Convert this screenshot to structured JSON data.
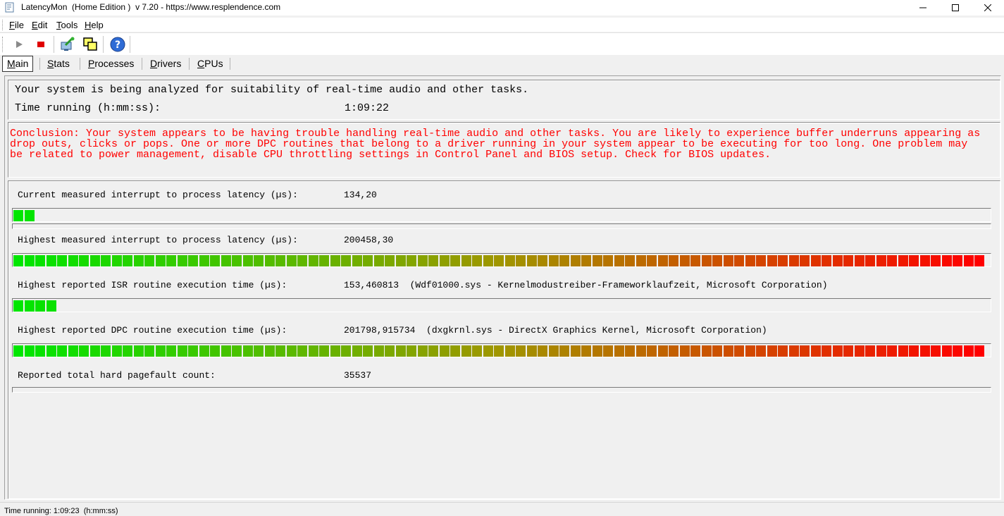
{
  "window": {
    "title": "LatencyMon  (Home Edition )  v 7.20 - https://www.resplendence.com"
  },
  "menu": {
    "items": [
      {
        "key": "F",
        "rest": "ile"
      },
      {
        "key": "E",
        "rest": "dit"
      },
      {
        "key": "T",
        "rest": "ools"
      },
      {
        "key": "H",
        "rest": "elp"
      }
    ]
  },
  "toolbar": {
    "icons": [
      "play-icon",
      "stop-icon",
      "analyze-icon",
      "window-icon",
      "help-icon"
    ]
  },
  "tabs": [
    {
      "key": "M",
      "rest": "ain",
      "active": true
    },
    {
      "key": "S",
      "rest": "tats",
      "active": false
    },
    {
      "key": "P",
      "rest": "rocesses",
      "active": false
    },
    {
      "key": "D",
      "rest": "rivers",
      "active": false
    },
    {
      "key": "C",
      "rest": "PUs",
      "active": false
    }
  ],
  "main": {
    "analysis_text": "Your system is being analyzed for suitability of real-time audio and other tasks.",
    "time_label": "Time running (h:mm:ss):",
    "time_value": "1:09:22",
    "conclusion": "Conclusion: Your system appears to be having trouble handling real-time audio and other tasks. You are likely to experience buffer underruns appearing as\ndrop outs, clicks or pops. One or more DPC routines that belong to a driver running in your system appear to be executing for too long. One problem may\nbe related to power management, disable CPU throttling settings in Control Panel and BIOS setup. Check for BIOS updates.",
    "rows": [
      {
        "label": "Current measured interrupt to process latency (µs):",
        "value": "134,20",
        "fill": 0.02
      },
      {
        "label": "Highest measured interrupt to process latency (µs):",
        "value": "200458,30",
        "fill": 1.0
      },
      {
        "label": "Highest reported ISR routine execution time (µs):",
        "value": "153,460813  (Wdf01000.sys - Kernelmodustreiber-Frameworklaufzeit, Microsoft Corporation)",
        "fill": 0.045
      },
      {
        "label": "Highest reported DPC routine execution time (µs):",
        "value": "201798,915734  (dxgkrnl.sys - DirectX Graphics Kernel, Microsoft Corporation)",
        "fill": 1.0
      },
      {
        "label": "Reported total hard pagefault count:",
        "value": "35537",
        "fill": 0
      }
    ]
  },
  "status": {
    "text": "Time running: 1:09:23  (h:mm:ss)"
  },
  "colors": {
    "conclusion": "#ff0000",
    "meter_start": "#00e600",
    "meter_end": "#ff0000"
  }
}
